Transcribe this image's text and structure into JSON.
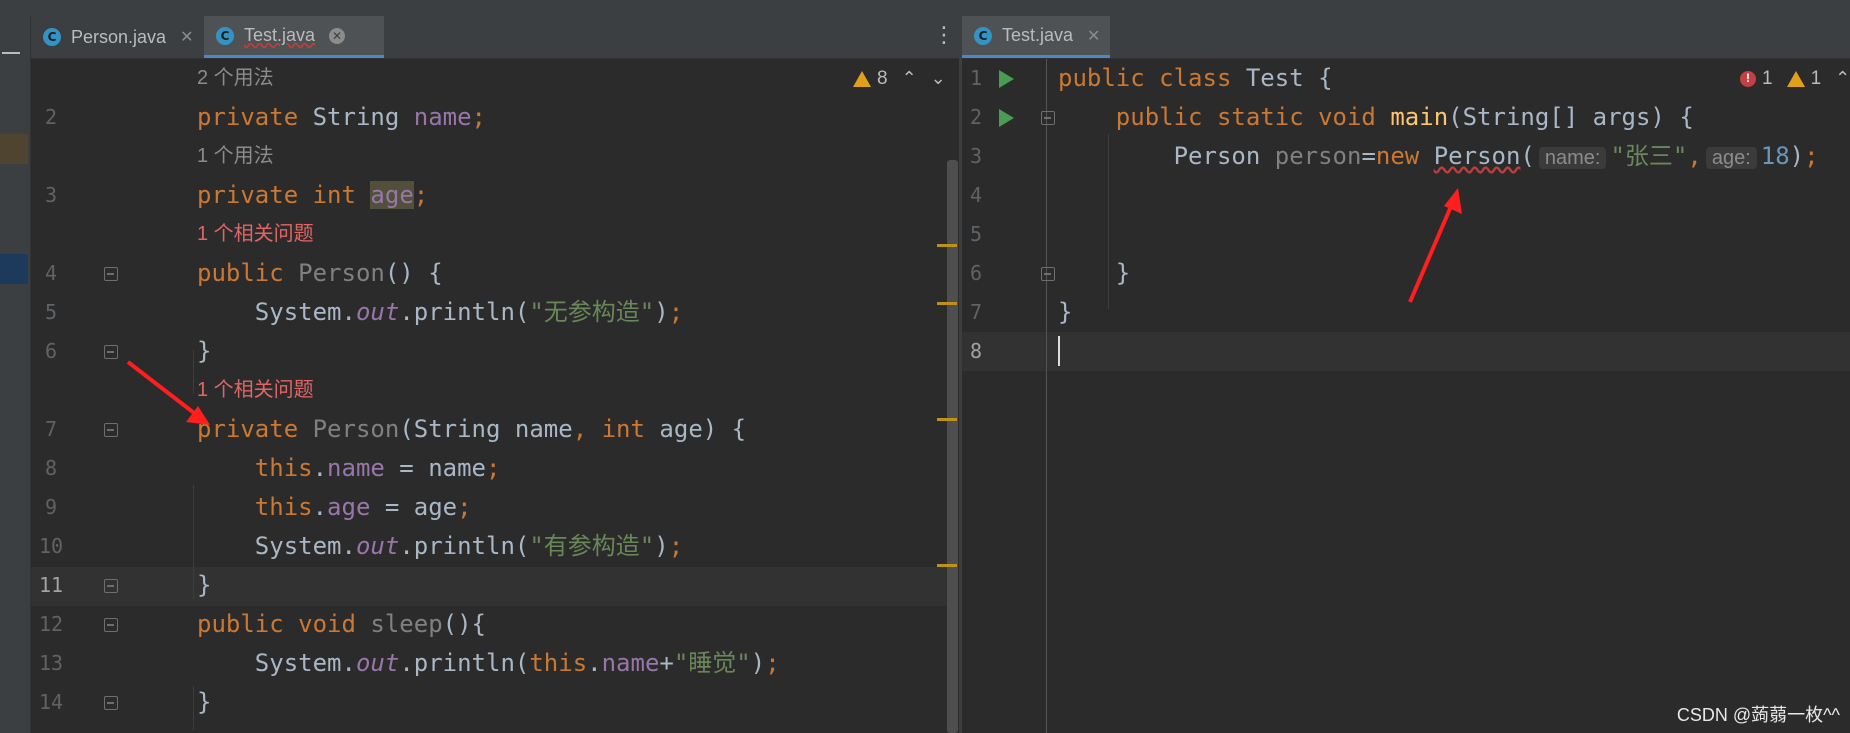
{
  "tabs_left": [
    {
      "label": "Person.java",
      "active": false,
      "icon": "java-class-icon",
      "close": "✕"
    },
    {
      "label": "Test.java",
      "active": true,
      "icon": "java-class-icon",
      "close": "✕"
    }
  ],
  "tabs_right": [
    {
      "label": "Test.java",
      "active": true,
      "icon": "java-class-icon",
      "close": "✕"
    }
  ],
  "left_editor": {
    "hint_usage_2": "2 个用法",
    "hint_usage_1": "1 个用法",
    "hint_problem_a": "1 个相关问题",
    "hint_problem_b": "1 个相关问题",
    "warnings_count": "8",
    "line_numbers": [
      "2",
      "3",
      "4",
      "5",
      "6",
      "7",
      "8",
      "9",
      "10",
      "11",
      "12",
      "13",
      "14"
    ],
    "str_noarg": "\"无参构造\"",
    "str_arg": "\"有参构造\"",
    "str_sleep": "\"睡觉\""
  },
  "right_editor": {
    "line_numbers": [
      "1",
      "2",
      "3",
      "4",
      "5",
      "6",
      "7",
      "8"
    ],
    "errors_count": "1",
    "warnings_count": "1",
    "param_name": "name:",
    "param_age": "age:",
    "str_name": "\"张三\"",
    "num_age": "18"
  },
  "watermark": "CSDN @蒟蒻一枚^^",
  "colors": {
    "keyword": "#cc7832",
    "field": "#9876aa",
    "string": "#6a8759",
    "number": "#6897bb",
    "method": "#ffc66d",
    "annotation_arrow": "#ff1f1f"
  }
}
